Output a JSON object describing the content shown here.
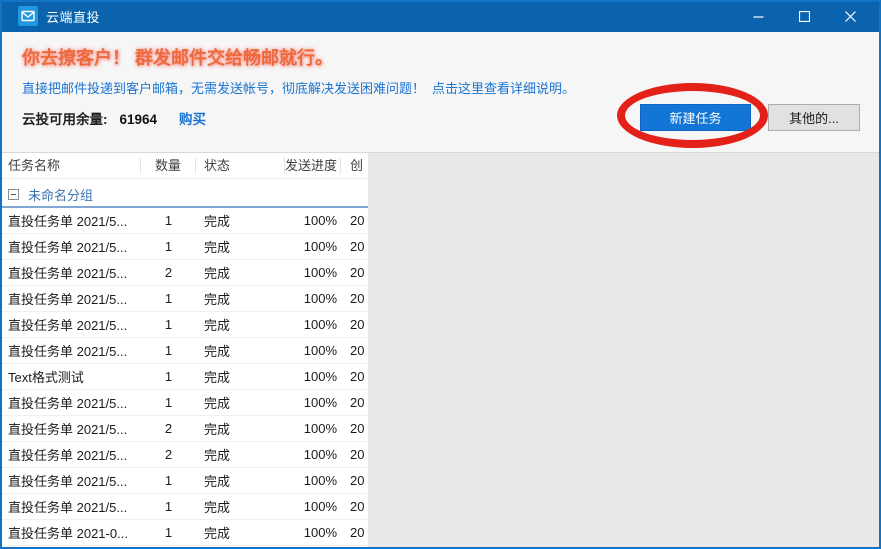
{
  "window": {
    "title": "云端直投"
  },
  "banner": {
    "headline": "你去撩客户！ 群发邮件交给畅邮就行。",
    "subline": "直接把邮件投递到客户邮箱，无需发送帐号，彻底解决发送困难问题！",
    "subline_link": "点击这里查看详细说明。",
    "balance_label": "云投可用余量:",
    "balance_value": "61964",
    "buy_link": "购买",
    "new_task_button": "新建任务",
    "other_button": "其他的..."
  },
  "table": {
    "columns": [
      "任务名称",
      "数量",
      "状态",
      "发送进度",
      "创"
    ],
    "group_label": "未命名分组",
    "rows": [
      {
        "name": "直投任务单 2021/5...",
        "qty": "1",
        "status": "完成",
        "progress": "100%",
        "created": "20"
      },
      {
        "name": "直投任务单 2021/5...",
        "qty": "1",
        "status": "完成",
        "progress": "100%",
        "created": "20"
      },
      {
        "name": "直投任务单 2021/5...",
        "qty": "2",
        "status": "完成",
        "progress": "100%",
        "created": "20"
      },
      {
        "name": "直投任务单 2021/5...",
        "qty": "1",
        "status": "完成",
        "progress": "100%",
        "created": "20"
      },
      {
        "name": "直投任务单 2021/5...",
        "qty": "1",
        "status": "完成",
        "progress": "100%",
        "created": "20"
      },
      {
        "name": "直投任务单 2021/5...",
        "qty": "1",
        "status": "完成",
        "progress": "100%",
        "created": "20"
      },
      {
        "name": "Text格式测试",
        "qty": "1",
        "status": "完成",
        "progress": "100%",
        "created": "20"
      },
      {
        "name": "直投任务单 2021/5...",
        "qty": "1",
        "status": "完成",
        "progress": "100%",
        "created": "20"
      },
      {
        "name": "直投任务单 2021/5...",
        "qty": "2",
        "status": "完成",
        "progress": "100%",
        "created": "20"
      },
      {
        "name": "直投任务单 2021/5...",
        "qty": "2",
        "status": "完成",
        "progress": "100%",
        "created": "20"
      },
      {
        "name": "直投任务单 2021/5...",
        "qty": "1",
        "status": "完成",
        "progress": "100%",
        "created": "20"
      },
      {
        "name": "直投任务单 2021/5...",
        "qty": "1",
        "status": "完成",
        "progress": "100%",
        "created": "20"
      },
      {
        "name": "直投任务单 2021-0...",
        "qty": "1",
        "status": "完成",
        "progress": "100%",
        "created": "20"
      }
    ]
  },
  "colors": {
    "titlebar": "#0a63ac",
    "window_border": "#1273c4",
    "accent_button": "#1176d5",
    "annotation_red": "#e32119",
    "headline_orange": "#ed6a3d",
    "link_blue": "#1b74d2",
    "group_blue": "#3b74b0",
    "side_panel_gray": "#e9e9e9"
  }
}
